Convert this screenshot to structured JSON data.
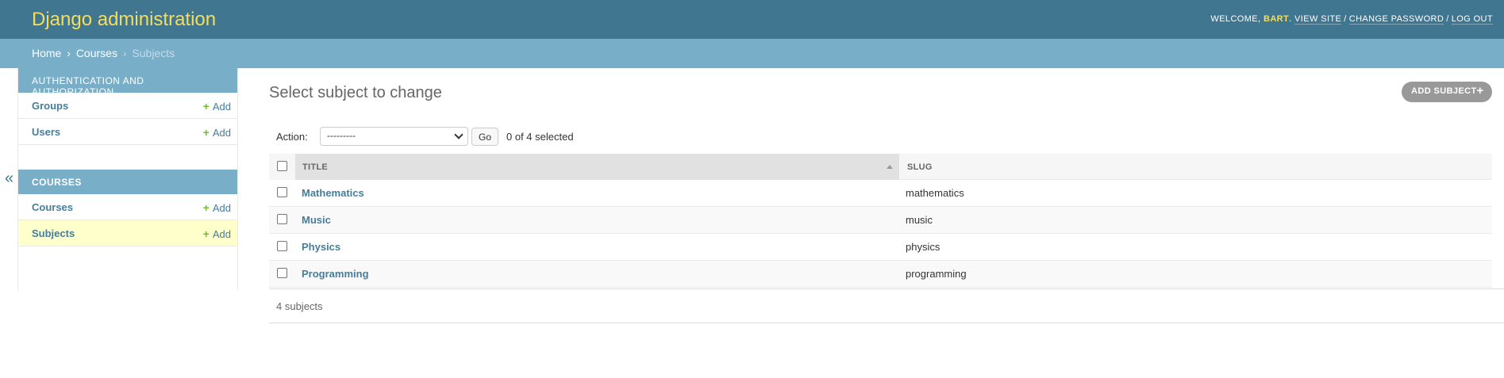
{
  "header": {
    "site_name": "Django administration",
    "welcome": "WELCOME, ",
    "username": "BART",
    "username_suffix": ". ",
    "view_site": "VIEW SITE",
    "change_password": "CHANGE PASSWORD",
    "log_out": "LOG OUT",
    "separator": "/"
  },
  "breadcrumbs": {
    "home": "Home",
    "app": "Courses",
    "current": "Subjects",
    "separator": "›"
  },
  "sidebar": {
    "toggle_glyph": "«",
    "modules": [
      {
        "caption": "Authentication and Authorization",
        "models": [
          {
            "name": "Groups",
            "add_label": "Add"
          },
          {
            "name": "Users",
            "add_label": "Add"
          }
        ]
      },
      {
        "caption": "Courses",
        "models": [
          {
            "name": "Courses",
            "add_label": "Add"
          },
          {
            "name": "Subjects",
            "add_label": "Add",
            "current": true
          }
        ]
      }
    ]
  },
  "content": {
    "title": "Select subject to change",
    "add_button": "ADD SUBJECT",
    "add_icon": "plus-icon"
  },
  "actions": {
    "label": "Action:",
    "selected_option": "---------",
    "go_label": "Go",
    "selected_count": "0 of 4 selected"
  },
  "table": {
    "columns": [
      "TITLE",
      "SLUG"
    ],
    "sort_column": "TITLE",
    "rows": [
      {
        "title": "Mathematics",
        "slug": "mathematics"
      },
      {
        "title": "Music",
        "slug": "music"
      },
      {
        "title": "Physics",
        "slug": "physics"
      },
      {
        "title": "Programming",
        "slug": "programming"
      }
    ]
  },
  "paginator": {
    "text": "4 subjects"
  },
  "colors": {
    "header_bg": "#417690",
    "branding": "#f5dd5d",
    "breadcrumbs_bg": "#79aec8",
    "link": "#447e9b",
    "add_green": "#70bf2b",
    "current_row": "#ffffcc"
  }
}
